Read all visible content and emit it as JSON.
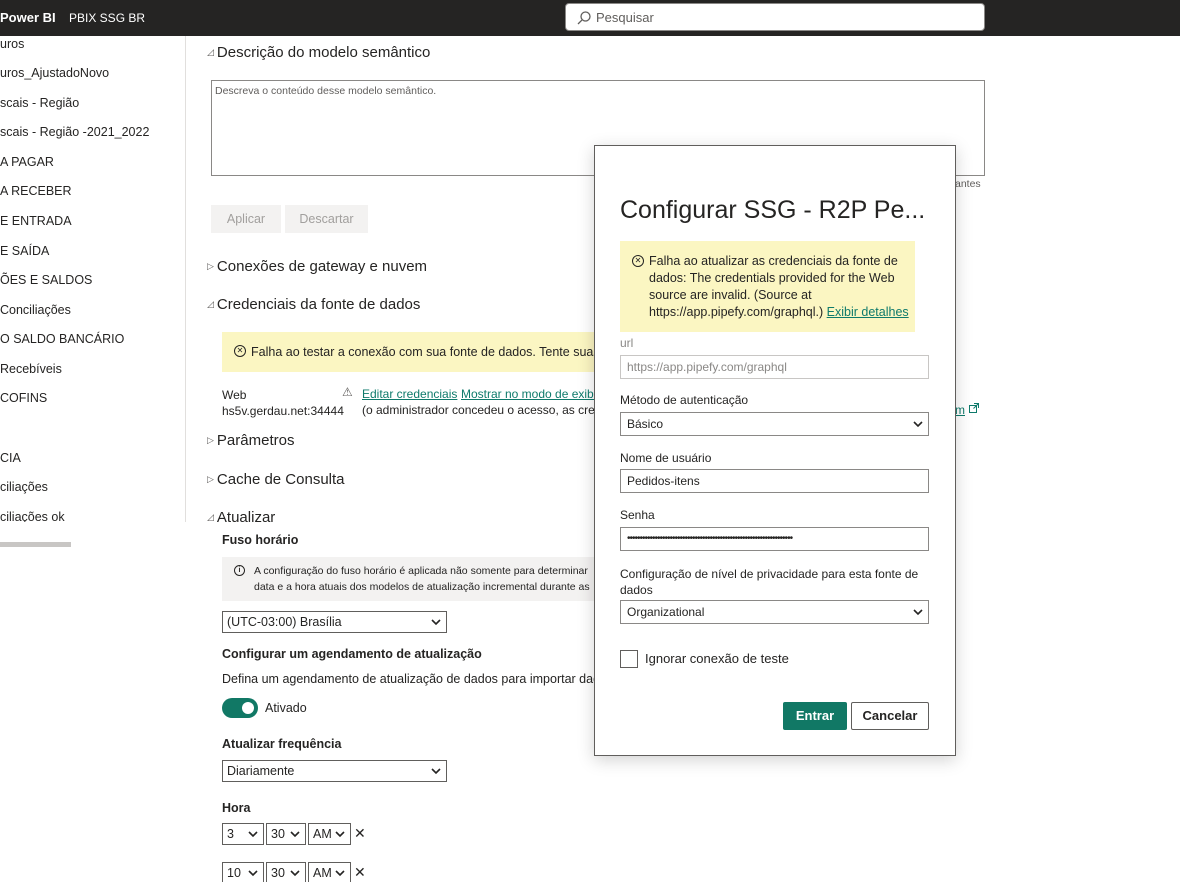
{
  "header": {
    "brand": "Power BI",
    "report_name": "PBIX SSG BR",
    "search_placeholder": "Pesquisar"
  },
  "sidebar": {
    "items": [
      "uros",
      "uros_AjustadoNovo",
      "scais - Região",
      "scais - Região -2021_2022",
      "A PAGAR",
      "A RECEBER",
      "E ENTRADA",
      "E SAÍDA",
      "ÕES E SALDOS",
      " Conciliações",
      "O SALDO BANCÁRIO",
      "Recebíveis",
      "COFINS",
      "CIA",
      "ciliações",
      "ciliações ok"
    ]
  },
  "main": {
    "desc_title": "Descrição do modelo semântico",
    "desc_placeholder": "Descreva o conteúdo desse modelo semântico.",
    "desc_counter": "antes",
    "apply_label": "Aplicar",
    "discard_label": "Descartar",
    "gateway_title": "Conexões de gateway e nuvem",
    "credentials_title": "Credenciais da fonte de dados",
    "credentials_warning": "Falha ao testar a conexão com sua fonte de dados. Tente suas",
    "cred_source_type": "Web",
    "cred_source_host": "hs5v.gerdau.net:34444",
    "edit_credentials": "Editar credenciais",
    "show_mode": "Mostrar no modo de exibição",
    "cred_note": "(o administrador concedeu o acesso, as credenciais",
    "right_link": "m",
    "params_title": "Parâmetros",
    "cache_title": "Cache de Consulta",
    "refresh_title": "Atualizar",
    "timezone_label": "Fuso horário",
    "timezone_info_1": "A configuração do fuso horário é aplicada não somente para determinar",
    "timezone_info_2": "data e a hora atuais dos modelos de atualização incremental durante as",
    "timezone_value": "(UTC-03:00) Brasília",
    "schedule_title": "Configurar um agendamento de atualização",
    "schedule_desc": "Defina um agendamento de atualização de dados para importar dados",
    "toggle_label": "Ativado",
    "frequency_label": "Atualizar frequência",
    "frequency_value": "Diariamente",
    "hour_label": "Hora",
    "times": [
      {
        "hour": "3",
        "minute": "30",
        "ampm": "AM"
      },
      {
        "hour": "10",
        "minute": "30",
        "ampm": "AM"
      }
    ]
  },
  "modal": {
    "title": "Configurar SSG - R2P Pe...",
    "error_text": "Falha ao atualizar as credenciais da fonte de dados: The credentials provided for the Web source are invalid. (Source at https://app.pipefy.com/graphql.)",
    "error_link": "Exibir detalhes",
    "url_label": "url",
    "url_value": "https://app.pipefy.com/graphql",
    "auth_label": "Método de autenticação",
    "auth_value": "Básico",
    "user_label": "Nome de usuário",
    "user_value": "Pedidos-itens",
    "pass_label": "Senha",
    "pass_value": "••••••••••••••••••••••••••••••••••••••••••••••••••••••••••••••••••",
    "privacy_label": "Configuração de nível de privacidade para esta fonte de dados",
    "privacy_value": "Organizational",
    "skip_test_label": "Ignorar conexão de teste",
    "submit_label": "Entrar",
    "cancel_label": "Cancelar"
  }
}
